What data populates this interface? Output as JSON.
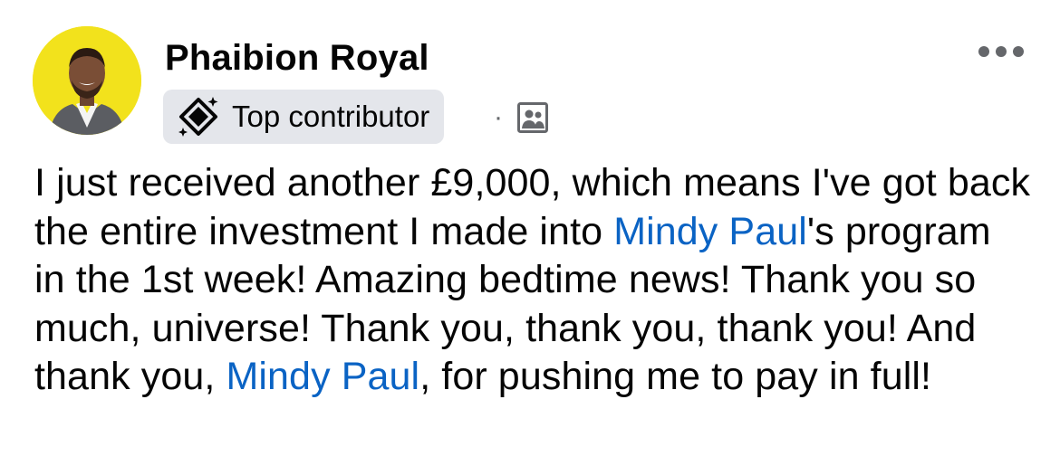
{
  "post": {
    "author": {
      "name": "Phaibion Royal",
      "avatar_bg": "#f2e21c"
    },
    "badge": {
      "label": "Top contributor",
      "icon": "diamond-sparkle-icon"
    },
    "separator": "·",
    "audience_icon": "group-icon",
    "more_icon": "more-horizontal-icon",
    "body": {
      "segments": [
        {
          "type": "text",
          "text": "I just received another £9,000, which means I've got back the entire investment I made into "
        },
        {
          "type": "mention",
          "text": "Mindy Paul"
        },
        {
          "type": "text",
          "text": "'s program in the 1st week! Amazing bedtime news! Thank you so much, universe! Thank you, thank you, thank you! And thank you, "
        },
        {
          "type": "mention",
          "text": "Mindy Paul"
        },
        {
          "type": "text",
          "text": ", for pushing me to pay in full!"
        }
      ]
    }
  },
  "colors": {
    "text": "#050505",
    "secondary": "#65676b",
    "mention": "#0a63c4",
    "badge_bg": "#e4e6eb"
  }
}
